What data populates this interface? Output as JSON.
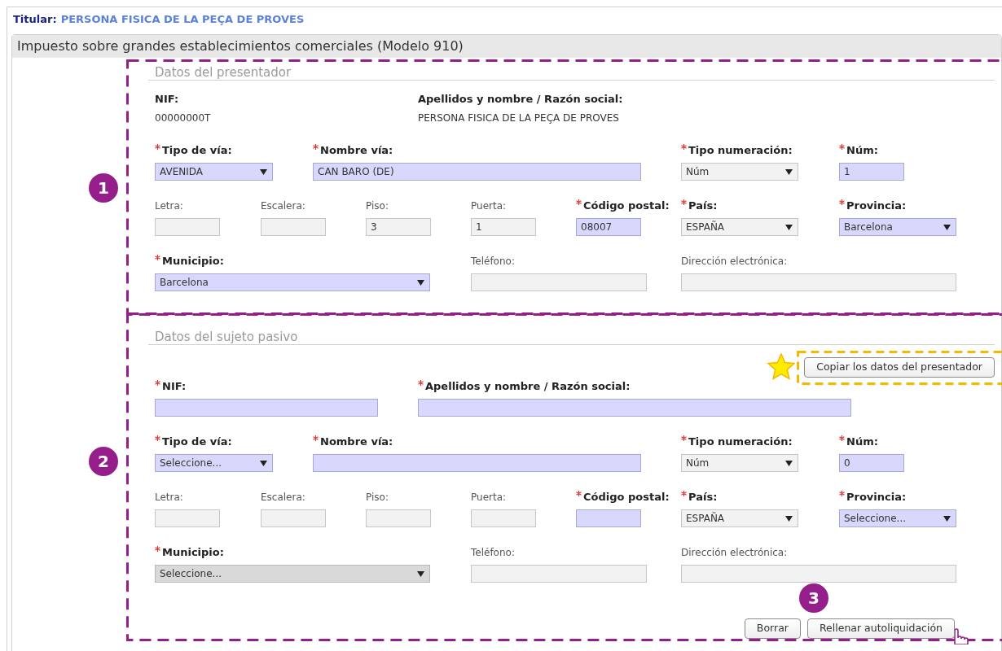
{
  "titular": {
    "label": "Titular:",
    "name": "PERSONA FISICA DE LA PEÇA DE PROVES"
  },
  "panel": {
    "title": "Impuesto sobre grandes establecimientos comerciales (Modelo 910)"
  },
  "sections": [
    {
      "title": "Datos del presentador",
      "badge": "1",
      "rows": [
        {
          "kind": "identity",
          "fields": [
            {
              "kind": "text",
              "label": "NIF:",
              "required": false,
              "value": "00000000T"
            },
            {
              "kind": "text",
              "label": "Apellidos y nombre / Razón social:",
              "required": false,
              "value": "PERSONA FISICA DE LA PEÇA DE PROVES"
            }
          ]
        },
        {
          "kind": "street",
          "fields": [
            {
              "kind": "select",
              "label": "Tipo de vía:",
              "required": true,
              "value": "AVENIDA",
              "highlighted": true,
              "disabled": false
            },
            {
              "kind": "input",
              "label": "Nombre vía:",
              "required": true,
              "value": "CAN BARO (DE)",
              "highlighted": true,
              "disabled": false
            },
            {
              "kind": "select",
              "label": "Tipo numeración:",
              "required": true,
              "value": "Núm",
              "highlighted": false,
              "disabled": false
            },
            {
              "kind": "input",
              "label": "Núm:",
              "required": true,
              "value": "1",
              "highlighted": true,
              "disabled": false
            }
          ]
        },
        {
          "kind": "address",
          "fields": [
            {
              "kind": "input",
              "label": "Letra:",
              "required": false,
              "highlighted": false,
              "disabled": false
            },
            {
              "kind": "input",
              "label": "Escalera:",
              "required": false,
              "highlighted": false,
              "disabled": false
            },
            {
              "kind": "input",
              "label": "Piso:",
              "required": false,
              "value": "3",
              "highlighted": false,
              "disabled": false
            },
            {
              "kind": "input",
              "label": "Puerta:",
              "required": false,
              "value": "1",
              "highlighted": false,
              "disabled": false
            },
            {
              "kind": "input",
              "label": "Código postal:",
              "required": true,
              "value": "08007",
              "highlighted": true,
              "disabled": false
            },
            {
              "kind": "select",
              "label": "País:",
              "required": true,
              "value": "ESPAÑA",
              "highlighted": false,
              "disabled": false
            },
            {
              "kind": "select",
              "label": "Provincia:",
              "required": true,
              "value": "Barcelona",
              "highlighted": true,
              "disabled": false
            }
          ]
        },
        {
          "kind": "contact",
          "fields": [
            {
              "kind": "select",
              "label": "Municipio:",
              "required": true,
              "value": "Barcelona",
              "highlighted": true,
              "disabled": false
            },
            {
              "kind": "input",
              "label": "Teléfono:",
              "required": false,
              "highlighted": false,
              "disabled": false
            },
            {
              "kind": "input",
              "label": "Dirección electrónica:",
              "required": false,
              "highlighted": false,
              "disabled": false
            }
          ]
        }
      ]
    },
    {
      "title": "Datos del sujeto pasivo",
      "badge": "2",
      "copy_button": "Copiar los datos del presentador",
      "rows": [
        {
          "kind": "identity",
          "fields": [
            {
              "kind": "input",
              "label": "NIF:",
              "required": true,
              "highlighted": true,
              "disabled": false
            },
            {
              "kind": "input",
              "label": "Apellidos y nombre / Razón social:",
              "required": true,
              "highlighted": true,
              "disabled": false
            }
          ]
        },
        {
          "kind": "street",
          "fields": [
            {
              "kind": "select",
              "label": "Tipo de vía:",
              "required": true,
              "value": "Seleccione...",
              "highlighted": true,
              "disabled": false
            },
            {
              "kind": "input",
              "label": "Nombre vía:",
              "required": true,
              "highlighted": true,
              "disabled": false
            },
            {
              "kind": "select",
              "label": "Tipo numeración:",
              "required": true,
              "value": "Núm",
              "highlighted": false,
              "disabled": false
            },
            {
              "kind": "input",
              "label": "Núm:",
              "required": true,
              "value": "0",
              "highlighted": true,
              "disabled": false
            }
          ]
        },
        {
          "kind": "address",
          "fields": [
            {
              "kind": "input",
              "label": "Letra:",
              "required": false,
              "highlighted": false,
              "disabled": false
            },
            {
              "kind": "input",
              "label": "Escalera:",
              "required": false,
              "highlighted": false,
              "disabled": false
            },
            {
              "kind": "input",
              "label": "Piso:",
              "required": false,
              "highlighted": false,
              "disabled": false
            },
            {
              "kind": "input",
              "label": "Puerta:",
              "required": false,
              "highlighted": false,
              "disabled": false
            },
            {
              "kind": "input",
              "label": "Código postal:",
              "required": true,
              "highlighted": true,
              "disabled": false
            },
            {
              "kind": "select",
              "label": "País:",
              "required": true,
              "value": "ESPAÑA",
              "highlighted": false,
              "disabled": false
            },
            {
              "kind": "select",
              "label": "Provincia:",
              "required": true,
              "value": "Seleccione...",
              "highlighted": true,
              "disabled": false
            }
          ]
        },
        {
          "kind": "contact",
          "fields": [
            {
              "kind": "select",
              "label": "Municipio:",
              "required": true,
              "value": "Seleccione...",
              "disabled": true
            },
            {
              "kind": "input",
              "label": "Teléfono:",
              "required": false,
              "highlighted": false,
              "disabled": false
            },
            {
              "kind": "input",
              "label": "Dirección electrónica:",
              "required": false,
              "highlighted": false,
              "disabled": false
            }
          ]
        }
      ],
      "actions": {
        "badge": "3",
        "buttons": [
          "Borrar",
          "Rellenar autoliquidación"
        ]
      }
    }
  ]
}
